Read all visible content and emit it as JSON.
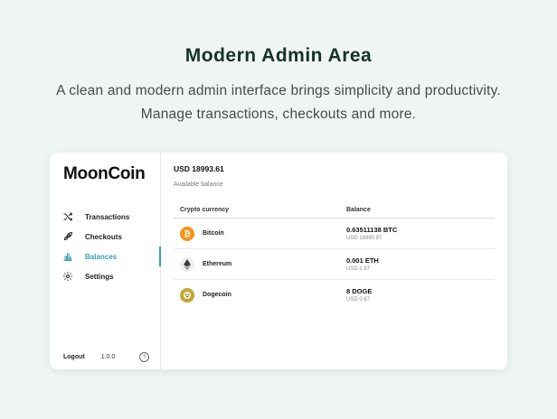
{
  "hero": {
    "title": "Modern Admin Area",
    "subtitle": "A clean and modern admin interface brings simplicity and productivity. Manage transactions, checkouts and more."
  },
  "app": {
    "brand": "MoonCoin",
    "nav": [
      {
        "label": "Transactions",
        "icon": "shuffle-icon",
        "active": false
      },
      {
        "label": "Checkouts",
        "icon": "rocket-icon",
        "active": false
      },
      {
        "label": "Balances",
        "icon": "bar-chart-icon",
        "active": true
      },
      {
        "label": "Settings",
        "icon": "gear-icon",
        "active": false
      }
    ],
    "footer": {
      "logout": "Logout",
      "version": "1.0.0",
      "help_glyph": "?"
    }
  },
  "balance": {
    "amount": "USD 18993.61",
    "label": "Available balance"
  },
  "table": {
    "headers": [
      "Crypto currency",
      "Balance"
    ],
    "rows": [
      {
        "name": "Bitcoin",
        "amount": "0.63511138 BTC",
        "usd": "USD 18990.97",
        "icon": "bitcoin-icon",
        "color": "#f7931a"
      },
      {
        "name": "Ethereum",
        "amount": "0.001 ETH",
        "usd": "USD 1.97",
        "icon": "ethereum-icon",
        "color": "#ecf0f1"
      },
      {
        "name": "Dogecoin",
        "amount": "8 DOGE",
        "usd": "USD 0.67",
        "icon": "dogecoin-icon",
        "color": "#c2a633"
      }
    ]
  },
  "colors": {
    "accent": "#3aa1ad",
    "background": "#eff5f3",
    "title": "#163328"
  }
}
